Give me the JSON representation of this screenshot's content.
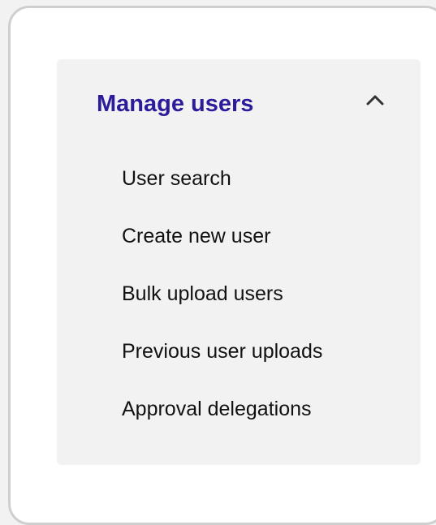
{
  "menu": {
    "title": "Manage users",
    "expanded": true,
    "toggle_icon": "chevron-up-icon",
    "title_color": "#2b1c9c",
    "items": [
      {
        "label": "User search"
      },
      {
        "label": "Create new user"
      },
      {
        "label": "Bulk upload users"
      },
      {
        "label": "Previous user uploads"
      },
      {
        "label": "Approval delegations"
      }
    ]
  }
}
